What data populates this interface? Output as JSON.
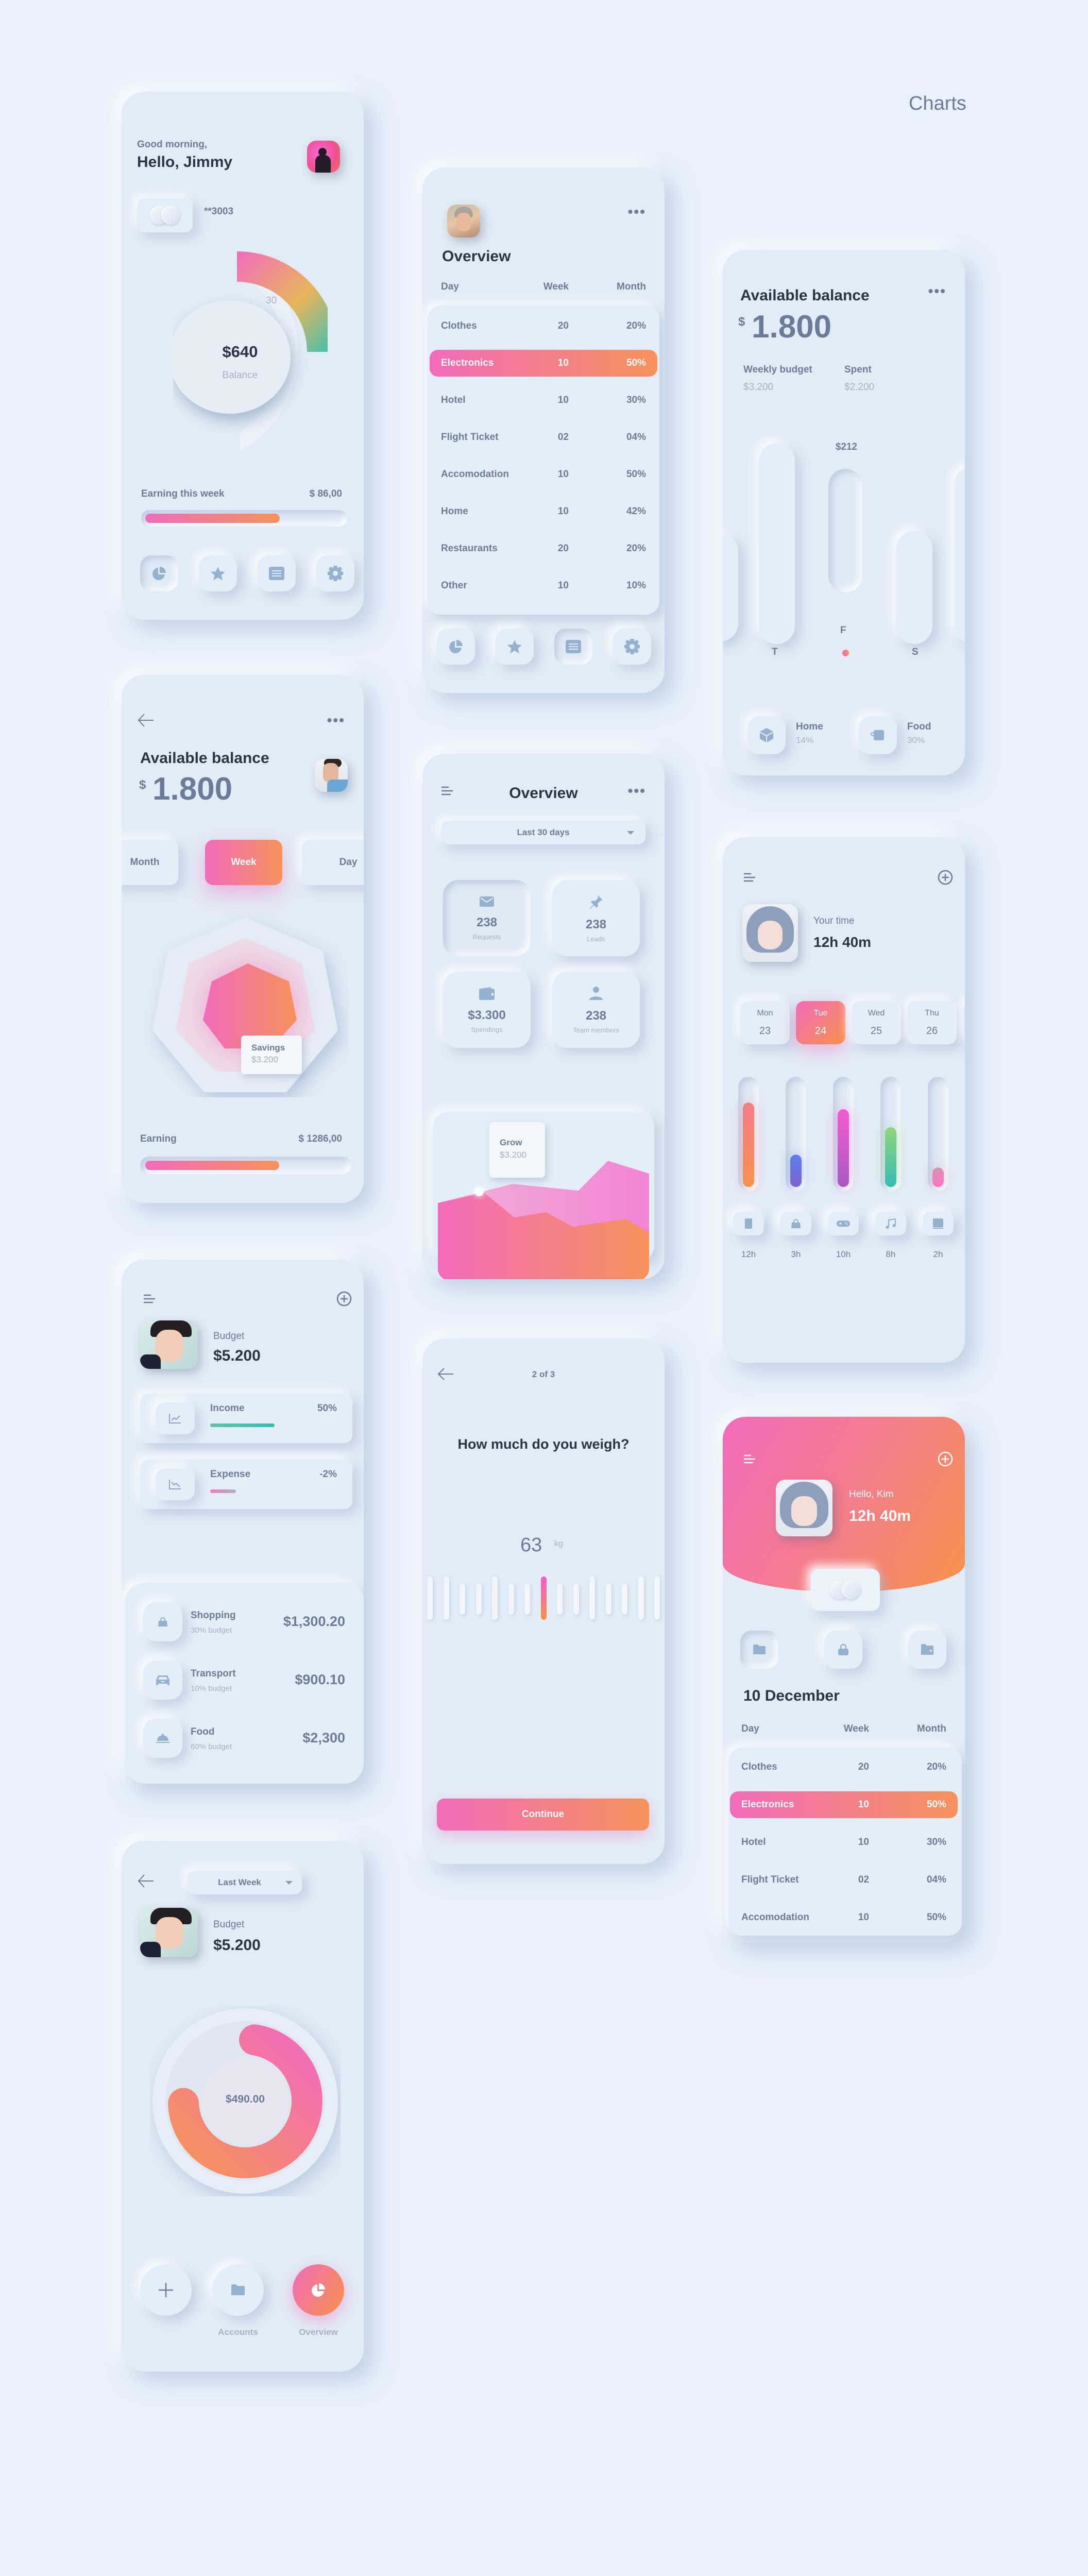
{
  "page": {
    "title": "Charts"
  },
  "colors": {
    "accent_start": "#f26bbb",
    "accent_end": "#f6925a",
    "background": "#e8f1fb",
    "text_dark": "#2a3446",
    "text_muted": "#6b7b98"
  },
  "card_home": {
    "greeting": "Good morning,",
    "name": "Hello, Jimmy",
    "card_number": "**3003",
    "gauge_value": "$640",
    "gauge_label": "Balance",
    "gauge_tick": "30",
    "earning_label": "Earning this week",
    "earning_value": "$ 86,00",
    "earning_progress": 0.68,
    "nav": [
      "pie-chart-icon",
      "star-icon",
      "list-icon",
      "gear-icon"
    ],
    "nav_active": 0
  },
  "card_overview_table": {
    "title": "Overview",
    "headers": [
      "Day",
      "Week",
      "Month"
    ],
    "rows": [
      [
        "Clothes",
        "20",
        "20%"
      ],
      [
        "Electronics",
        "10",
        "50%"
      ],
      [
        "Hotel",
        "10",
        "30%"
      ],
      [
        "Flight Ticket",
        "02",
        "04%"
      ],
      [
        "Accomodation",
        "10",
        "50%"
      ],
      [
        "Home",
        "10",
        "42%"
      ],
      [
        "Restaurants",
        "20",
        "20%"
      ],
      [
        "Other",
        "10",
        "10%"
      ]
    ],
    "highlight_row": 1,
    "nav_active": 2
  },
  "card_balance_bars": {
    "title": "Available balance",
    "currency": "$",
    "amount": "1.800",
    "weekly_budget_label": "Weekly budget",
    "weekly_budget_value": "$3.200",
    "spent_label": "Spent",
    "spent_value": "$2.200",
    "bar_tooltip": "$212",
    "day_labels": [
      "T",
      "F",
      "S"
    ],
    "active_day": "F",
    "categories": [
      {
        "icon": "box-icon",
        "label": "Home",
        "value": "14%"
      },
      {
        "icon": "cup-icon",
        "label": "Food",
        "value": "30%"
      }
    ]
  },
  "card_balance_polygon": {
    "title": "Available balance",
    "currency": "$",
    "amount": "1.800",
    "tabs": [
      "Month",
      "Week",
      "Day"
    ],
    "active_tab": 1,
    "tooltip_label": "Savings",
    "tooltip_value": "$3.200",
    "earning_label": "Earning",
    "earning_value": "$ 1286,00",
    "earning_progress": 0.66
  },
  "card_overview_stats": {
    "title": "Overview",
    "range_select": "Last 30 days",
    "stats": [
      {
        "icon": "mail-icon",
        "value": "238",
        "label": "Requests"
      },
      {
        "icon": "pin-icon",
        "value": "238",
        "label": "Leads"
      },
      {
        "icon": "wallet-icon",
        "value": "$3.300",
        "label": "Spendings"
      },
      {
        "icon": "user-icon",
        "value": "238",
        "label": "Team members"
      }
    ],
    "chart_tooltip_label": "Grow",
    "chart_tooltip_value": "$3.200"
  },
  "card_time": {
    "label": "Your time",
    "value": "12h 40m",
    "days": [
      {
        "name": "Mon",
        "num": "23"
      },
      {
        "name": "Tue",
        "num": "24"
      },
      {
        "name": "Wed",
        "num": "25"
      },
      {
        "name": "Thu",
        "num": "26"
      }
    ],
    "active_day": 1,
    "activities": [
      {
        "icon": "tablet-icon",
        "hours": "12h",
        "fraction": 0.78,
        "c1": "#f47c86",
        "c2": "#f6924e"
      },
      {
        "icon": "bag-icon",
        "hours": "3h",
        "fraction": 0.3,
        "c1": "#5c7ff0",
        "c2": "#8060cc"
      },
      {
        "icon": "gamepad-icon",
        "hours": "10h",
        "fraction": 0.72,
        "c1": "#f55bd0",
        "c2": "#a759c4"
      },
      {
        "icon": "music-icon",
        "hours": "8h",
        "fraction": 0.55,
        "c1": "#8ed67a",
        "c2": "#35bcb4"
      },
      {
        "icon": "book-icon",
        "hours": "2h",
        "fraction": 0.18,
        "c1": "#d593b0",
        "c2": "#ff73c4"
      }
    ]
  },
  "card_budget_list": {
    "budget_label": "Budget",
    "budget_value": "$5.200",
    "income_label": "Income",
    "income_value": "50%",
    "income_progress": 0.5,
    "expense_label": "Expense",
    "expense_value": "-2%",
    "expense_progress": 0.2,
    "items": [
      {
        "icon": "bag-icon",
        "name": "Shopping",
        "sub": "30% budget",
        "amount": "$1,300.20"
      },
      {
        "icon": "car-icon",
        "name": "Transport",
        "sub": "10% budget",
        "amount": "$900.10"
      },
      {
        "icon": "cloche-icon",
        "name": "Food",
        "sub": "60% budget",
        "amount": "$2,300"
      }
    ]
  },
  "card_weight": {
    "step": "2 of 3",
    "question": "How much do you weigh?",
    "value": "63",
    "unit": "kg",
    "button": "Continue"
  },
  "card_kim": {
    "greeting": "Hello, Kim",
    "value": "12h 40m",
    "actions": [
      "folder-icon",
      "lock-icon",
      "wallet-icon"
    ],
    "date_title": "10 December",
    "headers": [
      "Day",
      "Week",
      "Month"
    ],
    "rows": [
      [
        "Clothes",
        "20",
        "20%"
      ],
      [
        "Electronics",
        "10",
        "50%"
      ],
      [
        "Hotel",
        "10",
        "30%"
      ],
      [
        "Flight Ticket",
        "02",
        "04%"
      ],
      [
        "Accomodation",
        "10",
        "50%"
      ]
    ],
    "highlight_row": 1
  },
  "card_donut": {
    "range_select": "Last Week",
    "budget_label": "Budget",
    "budget_value": "$5.200",
    "donut_value": "$490.00",
    "donut_fraction": 0.72,
    "nav": [
      {
        "icon": "plus-icon",
        "label": ""
      },
      {
        "icon": "folder-icon",
        "label": "Accounts"
      },
      {
        "icon": "pie-chart-icon",
        "label": "Overview"
      }
    ],
    "nav_active": 2
  }
}
